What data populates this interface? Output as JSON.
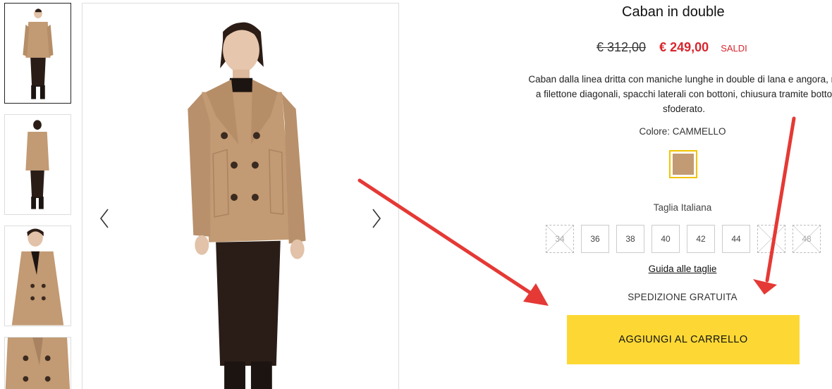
{
  "product": {
    "title": "Caban in double",
    "old_price": "€ 312,00",
    "new_price": "€ 249,00",
    "sale_badge": "SALDI",
    "description_lines": [
      "Caban dalla linea dritta con maniche lunghe in double di lana e angora, re",
      "a filettone diagonali, spacchi laterali con bottoni, chiusura tramite botto",
      "sfoderato."
    ],
    "color_label": "Colore: CAMMELLO",
    "color_swatch": "#c29a73",
    "size_label": "Taglia Italiana",
    "sizes": [
      {
        "label": "34",
        "available": false
      },
      {
        "label": "36",
        "available": true
      },
      {
        "label": "38",
        "available": true
      },
      {
        "label": "40",
        "available": true
      },
      {
        "label": "42",
        "available": true
      },
      {
        "label": "44",
        "available": true
      },
      {
        "label": "",
        "available": false
      },
      {
        "label": "48",
        "available": false
      }
    ],
    "size_guide": "Guida alle taglie",
    "shipping": "SPEDIZIONE GRATUITA",
    "add_to_cart": "AGGIUNGI AL CARRELLO"
  },
  "colors": {
    "accent": "#fdd835",
    "sale_red": "#d8262e",
    "annotation_arrow": "#e53935",
    "coat": "#c29a73",
    "skirt": "#2a1d17"
  },
  "gallery": {
    "thumbnail_count": 4,
    "active_thumbnail": 0,
    "nav_icons": [
      "chevron-left-icon",
      "chevron-right-icon"
    ]
  }
}
